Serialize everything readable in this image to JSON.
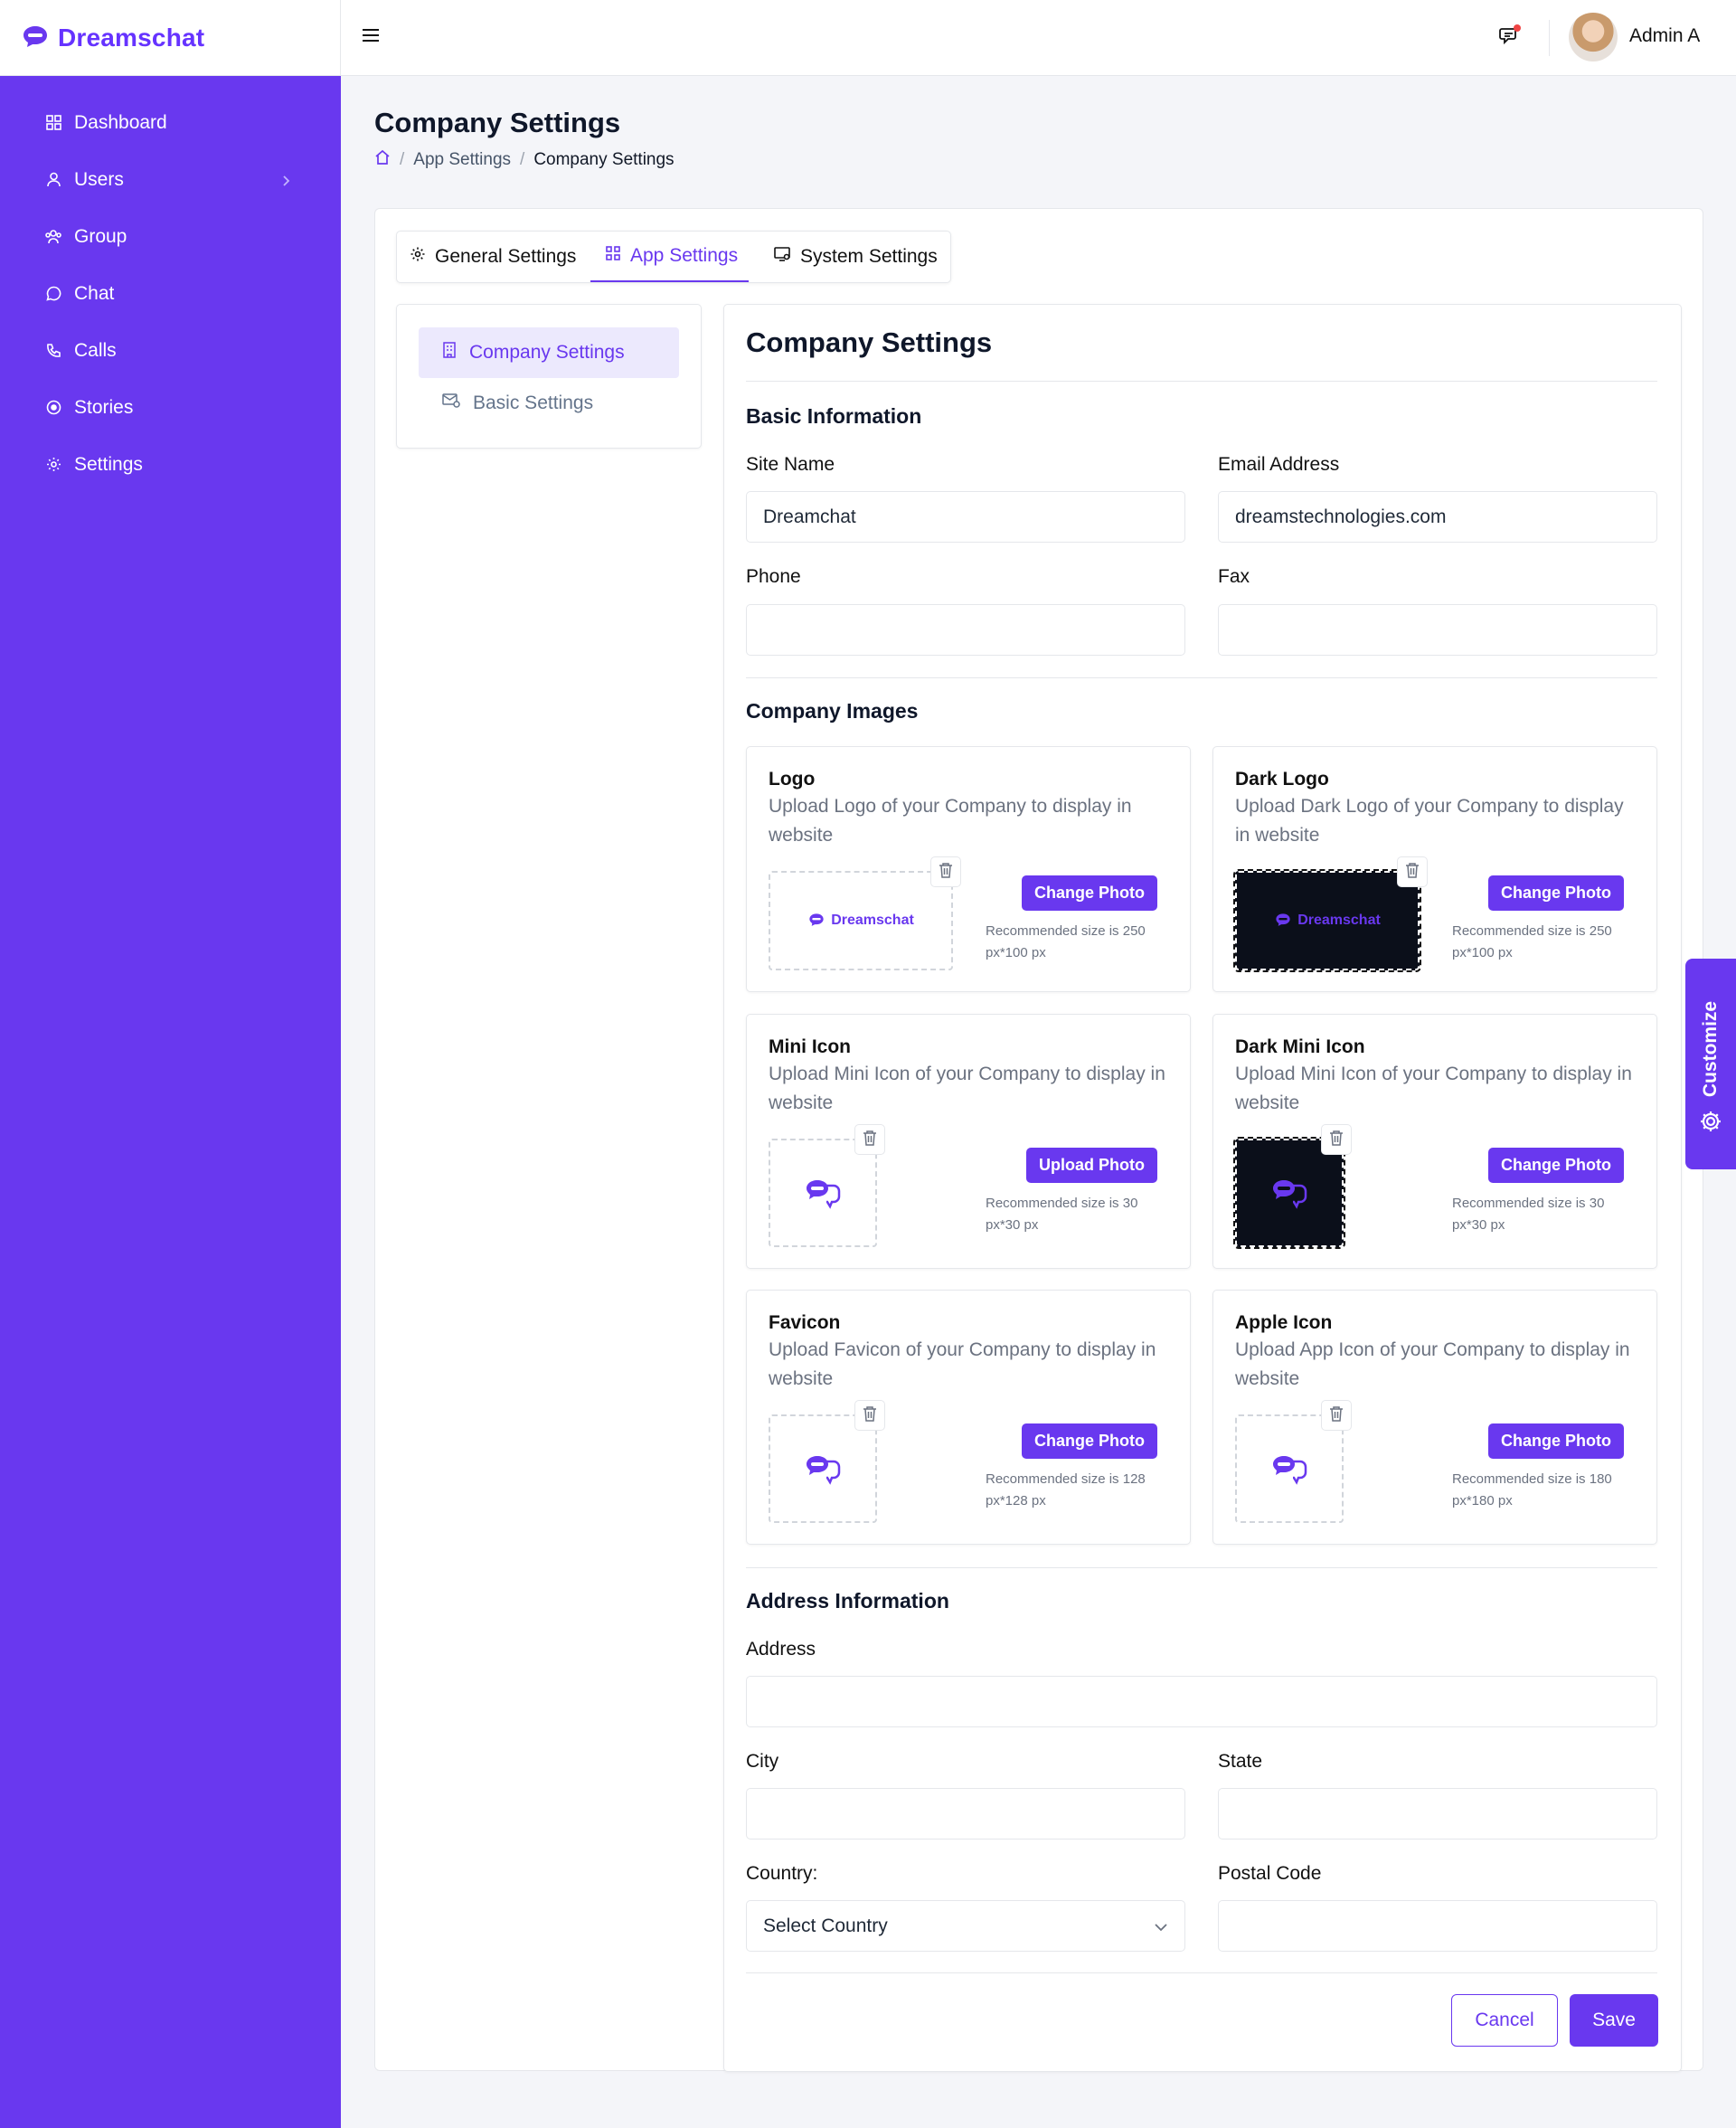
{
  "brand": {
    "name": "Dreamschat"
  },
  "sidebar": {
    "items": [
      {
        "label": "Dashboard",
        "icon": "dashboard-icon"
      },
      {
        "label": "Users",
        "icon": "user-icon",
        "has_submenu": true
      },
      {
        "label": "Group",
        "icon": "group-icon"
      },
      {
        "label": "Chat",
        "icon": "chat-icon"
      },
      {
        "label": "Calls",
        "icon": "phone-icon"
      },
      {
        "label": "Stories",
        "icon": "stories-icon"
      },
      {
        "label": "Settings",
        "icon": "settings-icon"
      }
    ]
  },
  "header": {
    "user_name": "Admin A",
    "has_notification": true
  },
  "page": {
    "title": "Company Settings",
    "breadcrumb": [
      "App Settings",
      "Company Settings"
    ]
  },
  "tabs": [
    {
      "label": "General Settings",
      "icon": "gear-icon"
    },
    {
      "label": "App Settings",
      "icon": "apps-icon",
      "active": true
    },
    {
      "label": "System Settings",
      "icon": "monitor-icon"
    }
  ],
  "submenu": [
    {
      "label": "Company Settings",
      "icon": "building-icon",
      "active": true
    },
    {
      "label": "Basic Settings",
      "icon": "mail-settings-icon"
    }
  ],
  "form": {
    "title": "Company Settings",
    "basic": {
      "heading": "Basic Information",
      "site_name_label": "Site Name",
      "site_name_value": "Dreamchat",
      "email_label": "Email Address",
      "email_value": "dreamstechnologies.com",
      "phone_label": "Phone",
      "phone_value": "",
      "fax_label": "Fax",
      "fax_value": ""
    },
    "images": {
      "heading": "Company Images",
      "cards": [
        {
          "title": "Logo",
          "desc": "Upload Logo of your Company to display in website",
          "button": "Change Photo",
          "rec": "Recommended size is 250 px*100 px",
          "preview_text": "Dreamschat"
        },
        {
          "title": "Dark Logo",
          "desc": "Upload Dark Logo of your Company to display in website",
          "button": "Change Photo",
          "rec": "Recommended size is 250 px*100 px",
          "preview_text": "Dreamschat"
        },
        {
          "title": "Mini Icon",
          "desc": "Upload Mini Icon of your Company to display in website",
          "button": "Upload Photo",
          "rec": "Recommended size is 30 px*30 px"
        },
        {
          "title": "Dark Mini Icon",
          "desc": "Upload Mini Icon of your Company to display in website",
          "button": "Change Photo",
          "rec": "Recommended size is 30 px*30 px"
        },
        {
          "title": "Favicon",
          "desc": "Upload Favicon of your Company to display in website",
          "button": "Change Photo",
          "rec": "Recommended size is 128 px*128 px"
        },
        {
          "title": "Apple Icon",
          "desc": "Upload App Icon of your Company to display in website",
          "button": "Change Photo",
          "rec": "Recommended size is 180 px*180 px"
        }
      ]
    },
    "address": {
      "heading": "Address Information",
      "address_label": "Address",
      "address_value": "",
      "city_label": "City",
      "city_value": "",
      "state_label": "State",
      "state_value": "",
      "country_label": "Country:",
      "country_value": "Select Country",
      "postal_label": "Postal Code",
      "postal_value": ""
    },
    "cancel": "Cancel",
    "save": "Save"
  },
  "customize": {
    "label": "Customize"
  },
  "colors": {
    "primary": "#6938ef",
    "sidebar": "#6938ef",
    "dark_preview": "#0b0f1a"
  }
}
